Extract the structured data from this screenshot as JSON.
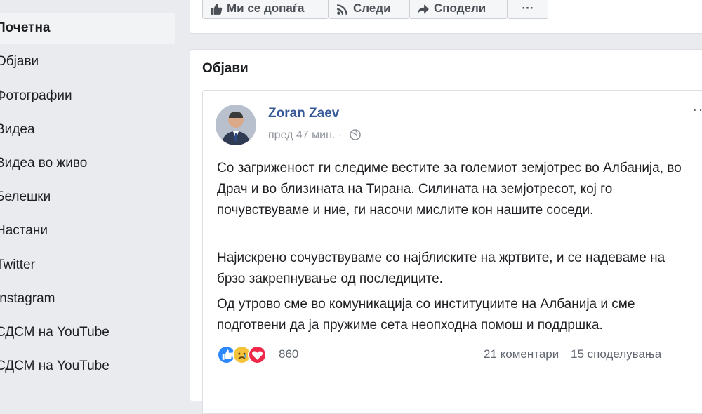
{
  "sidebar": {
    "items": [
      {
        "label": "Почетна",
        "active": true
      },
      {
        "label": "Објави"
      },
      {
        "label": "Фотографии"
      },
      {
        "label": "Видеа"
      },
      {
        "label": "Видеа во живо"
      },
      {
        "label": "Белешки"
      },
      {
        "label": "Настани"
      },
      {
        "label": "Twitter"
      },
      {
        "label": "Instagram"
      },
      {
        "label": "СДСМ на YouTube"
      },
      {
        "label": "СДСМ на YouTube"
      }
    ]
  },
  "actions": {
    "like_label": "Ми се допаѓа",
    "follow_label": "Следи",
    "share_label": "Сподели",
    "more_label": "···"
  },
  "posts_section": {
    "title": "Објави"
  },
  "post": {
    "author": "Zoran Zaev",
    "time": "пред 47 мин. ·",
    "more": "···",
    "paragraphs": [
      "Со загриженост ги следиме вестите за големиот земјотрес во Албанија, во Драч и во близината на Тирана. Силината на земјотресот, кој го почувствуваме и ние, ги насочи мислите кон нашите соседи.",
      "Најискрено сочувствуваме со најблиските на жртвите, и се надеваме на брзо закрепнување од последиците.",
      "Од утрово сме во комуникација со институциите на Албанија и сме подготвени да ја пружиме сета неопходна помош и поддршка."
    ],
    "reactions_count": "860",
    "comments": "21 коментари",
    "shares": "15 споделувања",
    "colors": {
      "like": "#2d88ff",
      "sad": "#f5c33b",
      "love": "#f0284a",
      "author": "#365899"
    }
  }
}
